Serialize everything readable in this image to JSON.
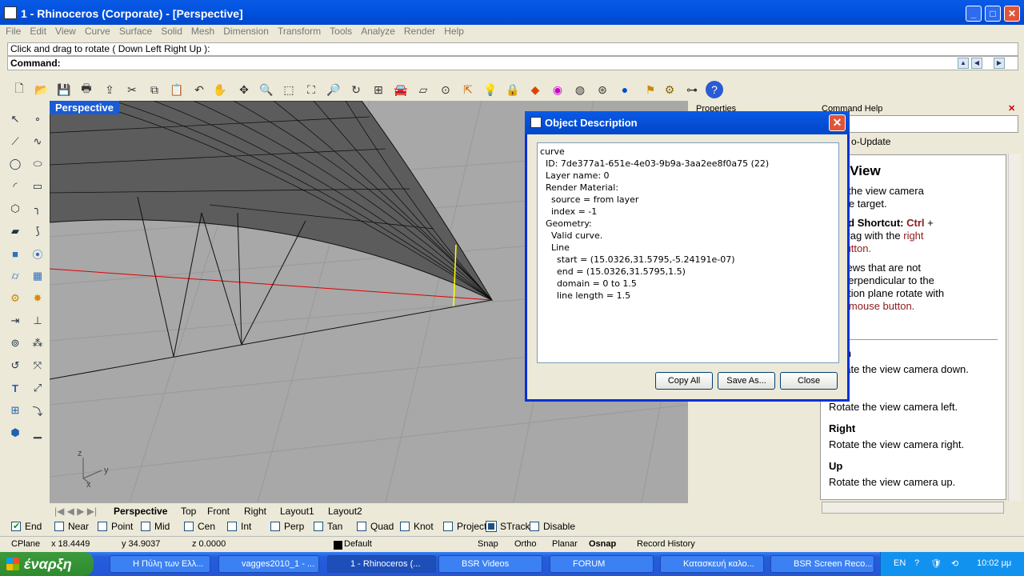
{
  "window": {
    "title": "1 - Rhinoceros (Corporate) - [Perspective]",
    "min": "_",
    "max": "□",
    "close": "✕"
  },
  "menu": [
    "File",
    "Edit",
    "View",
    "Curve",
    "Surface",
    "Solid",
    "Mesh",
    "Dimension",
    "Transform",
    "Tools",
    "Analyze",
    "Render",
    "Help"
  ],
  "command": {
    "prompt": "Click and drag to rotate ( Down  Left  Right  Up ):",
    "label": "Command:"
  },
  "viewport": {
    "label": "Perspective",
    "axis_x": "x",
    "axis_y": "y",
    "axis_z": "z"
  },
  "view_tabs": [
    "Perspective",
    "Top",
    "Front",
    "Right",
    "Layout1",
    "Layout2"
  ],
  "osnaps": [
    {
      "label": "End",
      "checked": true
    },
    {
      "label": "Near",
      "checked": false
    },
    {
      "label": "Point",
      "checked": false
    },
    {
      "label": "Mid",
      "checked": false
    },
    {
      "label": "Cen",
      "checked": false
    },
    {
      "label": "Int",
      "checked": false
    },
    {
      "label": "Perp",
      "checked": false
    },
    {
      "label": "Tan",
      "checked": false
    },
    {
      "label": "Quad",
      "checked": false
    },
    {
      "label": "Knot",
      "checked": false
    },
    {
      "label": "Project",
      "checked": false
    },
    {
      "label": "STrack",
      "checked": false
    },
    {
      "label": "Disable",
      "checked": false
    }
  ],
  "status": {
    "cplane": "CPlane",
    "x": "x 18.4449",
    "y": "y 34.9037",
    "z": "z 0.0000",
    "layer": "Default",
    "snap": "Snap",
    "ortho": "Ortho",
    "planar": "Planar",
    "osnap": "Osnap",
    "history": "Record History"
  },
  "panels": {
    "properties": "Properties",
    "command_help": "Command Help",
    "auto_update": "o-Update"
  },
  "help": {
    "heading": "tateView",
    "l1": "ates the view camera",
    "l2": "nd the target.",
    "l3a": "board Shortcut:",
    "l3b": "Ctrl",
    "l3c": "+",
    "l4a": "t",
    "l4b": "+ drag with the",
    "l4c": "right",
    "l5": "se button.",
    "l6a": "e:",
    "l6b": "Views that are not",
    "l7": "ing perpendicular to the",
    "l8": "struction plane rotate with",
    "l9": "right mouse button.",
    "options": "ions",
    "down_h": "wn",
    "down_t": "Rotate the view camera down.",
    "left_h": "t",
    "left_t": "Rotate the view camera left.",
    "right_h": "Right",
    "right_t": "Rotate the view camera right.",
    "up_h": "Up",
    "up_t": "Rotate the view camera up."
  },
  "dialog": {
    "title": "Object Description",
    "text": "curve\n  ID: 7de377a1-651e-4e03-9b9a-3aa2ee8f0a75 (22)\n  Layer name: 0\n  Render Material:\n    source = from layer\n    index = -1\n  Geometry:\n    Valid curve.\n    Line\n      start = (15.0326,31.5795,-5.24191e-07)\n      end = (15.0326,31.5795,1.5)\n      domain = 0 to 1.5\n      line length = 1.5",
    "copy_all": "Copy All",
    "save_as": "Save As...",
    "close": "Close"
  },
  "taskbar": {
    "start": "έναρξη",
    "tasks": [
      "Η Πύλη των Ελλ...",
      "vagges2010_1 - ...",
      "1 - Rhinoceros (...",
      "BSR Videos",
      "FORUM",
      "Κατασκευή καλο...",
      "BSR Screen Reco..."
    ],
    "lang": "EN",
    "time": "10:02 μμ"
  },
  "colors": {
    "titlebar": "#0054e3",
    "viewport": "#a8a8a8",
    "xaxis": "#e00000",
    "selected": "#ffff00"
  }
}
